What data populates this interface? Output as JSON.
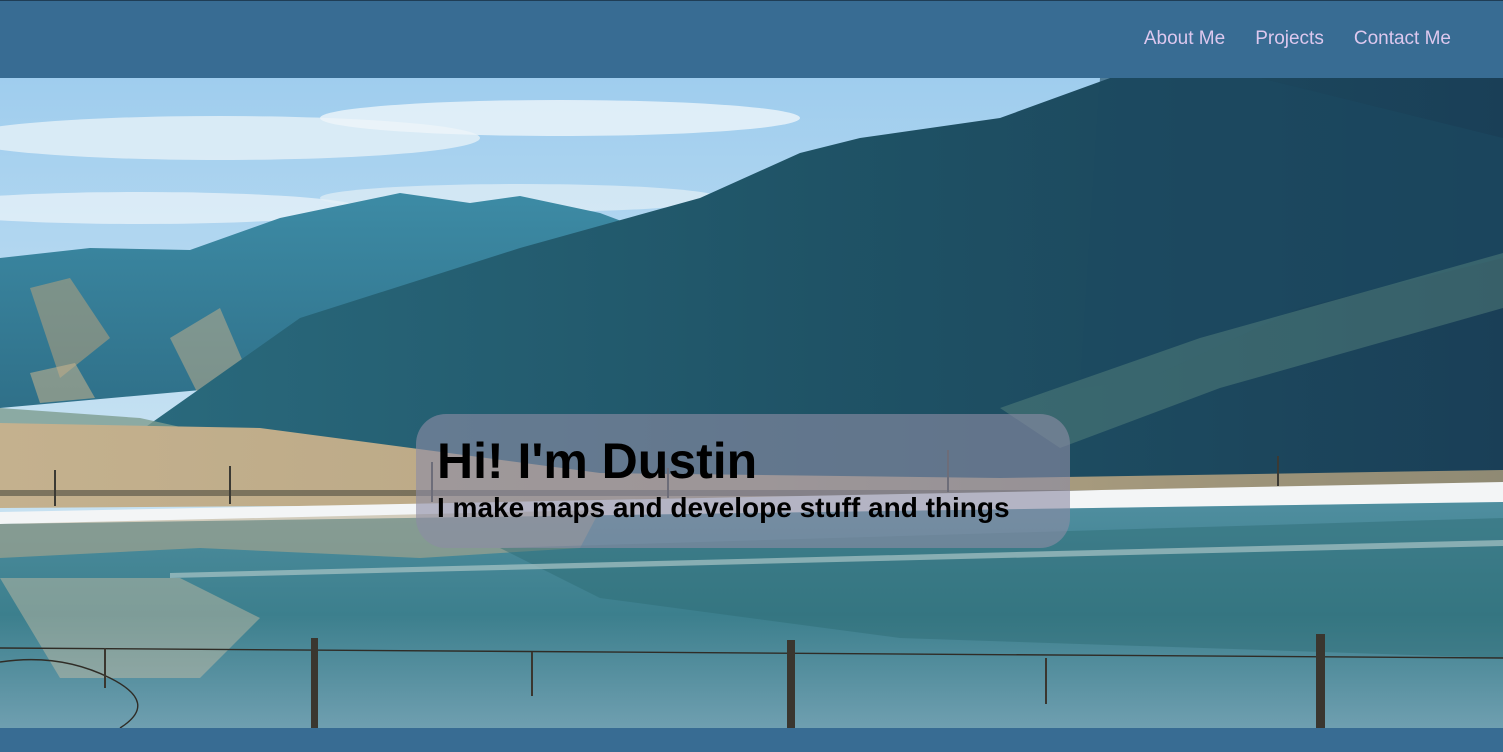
{
  "nav": {
    "links": [
      {
        "label": "About Me"
      },
      {
        "label": "Projects"
      },
      {
        "label": "Contact Me"
      }
    ]
  },
  "hero": {
    "image": "mountain-lake-reflection-photo",
    "title": "Hi! I'm Dustin",
    "subtitle": "I make maps and develope stuff and things"
  },
  "colors": {
    "navbar": "#386c93",
    "nav_link": "#ddc8ee",
    "card": "#8c8ca5",
    "text": "#000000"
  }
}
